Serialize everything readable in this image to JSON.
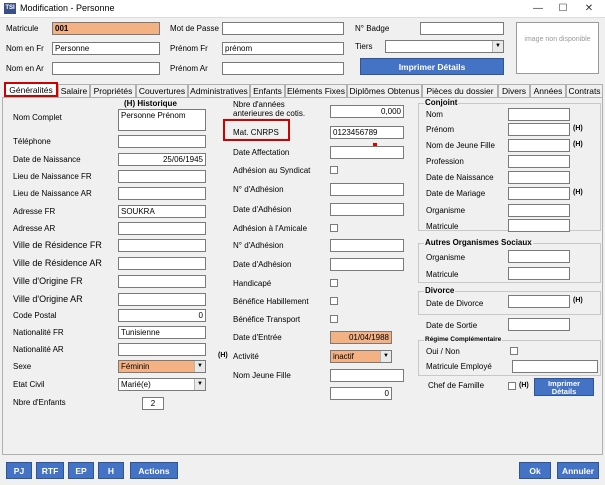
{
  "window": {
    "title": "Modification - Personne",
    "app_icon": "TSI"
  },
  "header": {
    "matricule_label": "Matricule",
    "matricule": "001",
    "mot_de_passe_label": "Mot de Passe",
    "badge_label": "N° Badge",
    "nom_fr_label": "Nom en Fr",
    "nom_fr": "Personne",
    "prenom_fr_label": "Prénom Fr",
    "prenom_fr": "prénom",
    "tiers_label": "Tiers",
    "nom_ar_label": "Nom en Ar",
    "prenom_ar_label": "Prénom Ar",
    "imprimer_details": "Imprimer Détails",
    "image_placeholder": "image non disponible"
  },
  "tabs": [
    "Généralités",
    "Salaire",
    "Propriétés",
    "Couvertures",
    "Administratives",
    "Enfants",
    "Eléments Fixes",
    "Diplômes Obtenus",
    "Pièces du dossier",
    "Divers",
    "Années",
    "Contrats"
  ],
  "col1": {
    "historique": "(H) Historique",
    "nom_complet_label": "Nom Complet",
    "nom_complet": "Personne Prénom",
    "telephone_label": "Téléphone",
    "date_naissance_label": "Date de Naissance",
    "date_naissance": "25/06/1945",
    "lieu_naissance_fr_label": "Lieu de Naissance FR",
    "lieu_naissance_ar_label": "Lieu de Naissance AR",
    "adresse_fr_label": "Adresse FR",
    "adresse_fr": "SOUKRA",
    "adresse_ar_label": "Adresse AR",
    "ville_res_fr_label": "Ville de Résidence FR",
    "ville_res_ar_label": "Ville de Résidence AR",
    "ville_orig_fr_label": "Ville d'Origine FR",
    "ville_orig_ar_label": "Ville d'Origine AR",
    "code_postal_label": "Code Postal",
    "code_postal": "0",
    "nationalite_fr_label": "Nationalité FR",
    "nationalite_fr": "Tunisienne",
    "nationalite_ar_label": "Nationalité AR",
    "sexe_label": "Sexe",
    "sexe": "Féminin",
    "sexe_h": "(H)",
    "etat_civil_label": "Etat Civil",
    "etat_civil": "Marié(e)",
    "nbre_enfants_label": "Nbre d'Enfants",
    "nbre_enfants": "2"
  },
  "col2": {
    "nbre_annees_label": "Nbre d'années anterieures de cotis.",
    "nbre_annees": "0,000",
    "mat_cnrps_label": "Mat. CNRPS",
    "mat_cnrps": "0123456789",
    "date_affectation_label": "Date Affectation",
    "adhesion_syndicat_label": "Adhésion au Syndicat",
    "n_adhesion1_label": "N° d'Adhésion",
    "date_adhesion1_label": "Date d'Adhésion",
    "adhesion_amicale_label": "Adhésion à l'Amicale",
    "n_adhesion2_label": "N° d'Adhésion",
    "date_adhesion2_label": "Date d'Adhésion",
    "handicape_label": "Handicapé",
    "benef_habillement_label": "Bénéfice Habillement",
    "benef_transport_label": "Bénéfice Transport",
    "date_entree_label": "Date d'Entrée",
    "date_entree": "01/04/1988",
    "activite_label": "Activité",
    "activite": "inactif",
    "nom_jeune_fille_label": "Nom Jeune Fille",
    "last_value": "0"
  },
  "col3": {
    "conjoint_title": "Conjoint",
    "nom_label": "Nom",
    "prenom_label": "Prénom",
    "nom_jeune_fille_label": "Nom de Jeune Fille",
    "profession_label": "Profession",
    "date_naissance_label": "Date de Naissance",
    "date_mariage_label": "Date de Mariage",
    "organisme_label": "Organisme",
    "matricule_label": "Matricule",
    "autres_title": "Autres Organismes Sociaux",
    "autres_organisme_label": "Organisme",
    "autres_matricule_label": "Matricule",
    "divorce_title": "Divorce",
    "date_divorce_label": "Date de Divorce",
    "date_sortie_label": "Date de Sortie",
    "regime_title": "Régime Complémentaire",
    "oui_non_label": "Oui / Non",
    "matricule_employe_label": "Matricule Employé",
    "chef_famille_label": "Chef de Famille",
    "imprimer_details": "Imprimer Détails",
    "h": "(H)"
  },
  "footer": {
    "pj": "PJ",
    "rtf": "RTF",
    "ep": "EP",
    "h": "H",
    "actions": "Actions",
    "ok": "Ok",
    "annuler": "Annuler"
  }
}
